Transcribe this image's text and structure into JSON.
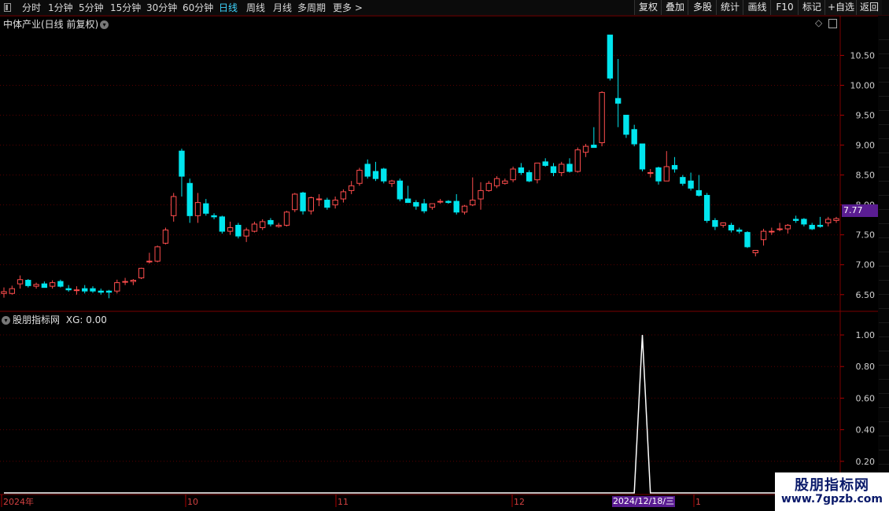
{
  "toolbar": {
    "periods": [
      "分时",
      "1分钟",
      "5分钟",
      "15分钟",
      "30分钟",
      "60分钟",
      "日线",
      "周线",
      "月线",
      "多周期",
      "更多 >"
    ],
    "active_period": "日线",
    "buttons": [
      "复权",
      "叠加",
      "多股",
      "统计",
      "画线",
      "F10",
      "标记",
      "+自选",
      "返回"
    ]
  },
  "main_panel": {
    "title": "中体产业(日线 前复权)",
    "current_price": "7.77"
  },
  "indicator_panel": {
    "title": "股朋指标网",
    "value_text": "XG: 0.00"
  },
  "x_axis": {
    "labels": [
      "2024年",
      "10",
      "11",
      "12",
      "1"
    ],
    "cursor_date": "2024/12/18/三"
  },
  "watermark": {
    "title": "股朋指标网",
    "url": "www.7gpzb.com"
  },
  "colors": {
    "up": "#ff4d4d",
    "down": "#00e5ee",
    "grid": "#5a0000",
    "indicator_line": "#ffffff",
    "active_tab": "#3fd6ff"
  },
  "chart_data": [
    {
      "type": "candlestick",
      "ylim": [
        6.3,
        10.9
      ],
      "yticks": [
        "10.50",
        "10.00",
        "9.50",
        "9.00",
        "8.50",
        "8.00",
        "7.50",
        "7.00",
        "6.50"
      ],
      "candles": [
        {
          "o": 6.52,
          "h": 6.62,
          "l": 6.45,
          "c": 6.55
        },
        {
          "o": 6.52,
          "h": 6.65,
          "l": 6.5,
          "c": 6.6
        },
        {
          "o": 6.68,
          "h": 6.82,
          "l": 6.6,
          "c": 6.75
        },
        {
          "o": 6.74,
          "h": 6.76,
          "l": 6.62,
          "c": 6.65
        },
        {
          "o": 6.64,
          "h": 6.7,
          "l": 6.6,
          "c": 6.67
        },
        {
          "o": 6.68,
          "h": 6.72,
          "l": 6.62,
          "c": 6.62
        },
        {
          "o": 6.64,
          "h": 6.74,
          "l": 6.6,
          "c": 6.7
        },
        {
          "o": 6.72,
          "h": 6.75,
          "l": 6.62,
          "c": 6.64
        },
        {
          "o": 6.6,
          "h": 6.66,
          "l": 6.55,
          "c": 6.58
        },
        {
          "o": 6.58,
          "h": 6.64,
          "l": 6.5,
          "c": 6.58
        },
        {
          "o": 6.6,
          "h": 6.66,
          "l": 6.52,
          "c": 6.56
        },
        {
          "o": 6.6,
          "h": 6.64,
          "l": 6.53,
          "c": 6.56
        },
        {
          "o": 6.56,
          "h": 6.6,
          "l": 6.5,
          "c": 6.54
        },
        {
          "o": 6.56,
          "h": 6.58,
          "l": 6.44,
          "c": 6.54
        },
        {
          "o": 6.56,
          "h": 6.75,
          "l": 6.52,
          "c": 6.7
        },
        {
          "o": 6.72,
          "h": 6.78,
          "l": 6.66,
          "c": 6.72
        },
        {
          "o": 6.72,
          "h": 6.76,
          "l": 6.66,
          "c": 6.74
        },
        {
          "o": 6.78,
          "h": 6.95,
          "l": 6.76,
          "c": 6.94
        },
        {
          "o": 7.05,
          "h": 7.2,
          "l": 7.02,
          "c": 7.06
        },
        {
          "o": 7.06,
          "h": 7.32,
          "l": 7.04,
          "c": 7.3
        },
        {
          "o": 7.36,
          "h": 7.62,
          "l": 7.34,
          "c": 7.58
        },
        {
          "o": 7.82,
          "h": 8.2,
          "l": 7.72,
          "c": 8.14
        },
        {
          "o": 8.9,
          "h": 8.94,
          "l": 8.14,
          "c": 8.48
        },
        {
          "o": 8.36,
          "h": 8.44,
          "l": 7.7,
          "c": 7.82
        },
        {
          "o": 7.82,
          "h": 8.2,
          "l": 7.7,
          "c": 8.04
        },
        {
          "o": 8.02,
          "h": 8.1,
          "l": 7.82,
          "c": 7.86
        },
        {
          "o": 7.82,
          "h": 7.86,
          "l": 7.76,
          "c": 7.8
        },
        {
          "o": 7.8,
          "h": 7.82,
          "l": 7.52,
          "c": 7.56
        },
        {
          "o": 7.56,
          "h": 7.72,
          "l": 7.5,
          "c": 7.62
        },
        {
          "o": 7.66,
          "h": 7.7,
          "l": 7.44,
          "c": 7.48
        },
        {
          "o": 7.48,
          "h": 7.62,
          "l": 7.38,
          "c": 7.58
        },
        {
          "o": 7.56,
          "h": 7.72,
          "l": 7.54,
          "c": 7.68
        },
        {
          "o": 7.62,
          "h": 7.76,
          "l": 7.58,
          "c": 7.72
        },
        {
          "o": 7.74,
          "h": 7.78,
          "l": 7.64,
          "c": 7.68
        },
        {
          "o": 7.64,
          "h": 7.7,
          "l": 7.62,
          "c": 7.66
        },
        {
          "o": 7.66,
          "h": 7.9,
          "l": 7.64,
          "c": 7.88
        },
        {
          "o": 7.92,
          "h": 8.2,
          "l": 7.88,
          "c": 8.18
        },
        {
          "o": 8.2,
          "h": 8.22,
          "l": 7.84,
          "c": 7.9
        },
        {
          "o": 7.9,
          "h": 8.14,
          "l": 7.84,
          "c": 8.12
        },
        {
          "o": 8.1,
          "h": 8.18,
          "l": 7.98,
          "c": 8.1
        },
        {
          "o": 8.08,
          "h": 8.12,
          "l": 7.92,
          "c": 7.96
        },
        {
          "o": 8.0,
          "h": 8.14,
          "l": 7.94,
          "c": 8.08
        },
        {
          "o": 8.1,
          "h": 8.26,
          "l": 8.04,
          "c": 8.22
        },
        {
          "o": 8.24,
          "h": 8.4,
          "l": 8.18,
          "c": 8.32
        },
        {
          "o": 8.36,
          "h": 8.62,
          "l": 8.32,
          "c": 8.58
        },
        {
          "o": 8.68,
          "h": 8.76,
          "l": 8.44,
          "c": 8.48
        },
        {
          "o": 8.56,
          "h": 8.72,
          "l": 8.4,
          "c": 8.44
        },
        {
          "o": 8.6,
          "h": 8.62,
          "l": 8.36,
          "c": 8.4
        },
        {
          "o": 8.36,
          "h": 8.42,
          "l": 8.3,
          "c": 8.4
        },
        {
          "o": 8.4,
          "h": 8.44,
          "l": 8.06,
          "c": 8.1
        },
        {
          "o": 8.1,
          "h": 8.32,
          "l": 8.04,
          "c": 8.04
        },
        {
          "o": 8.04,
          "h": 8.08,
          "l": 7.92,
          "c": 7.98
        },
        {
          "o": 8.02,
          "h": 8.1,
          "l": 7.86,
          "c": 7.9
        },
        {
          "o": 7.96,
          "h": 8.02,
          "l": 7.92,
          "c": 8.02
        },
        {
          "o": 8.06,
          "h": 8.1,
          "l": 8.02,
          "c": 8.06
        },
        {
          "o": 8.06,
          "h": 8.08,
          "l": 8.02,
          "c": 8.04
        },
        {
          "o": 8.06,
          "h": 8.18,
          "l": 7.84,
          "c": 7.88
        },
        {
          "o": 7.88,
          "h": 8.0,
          "l": 7.84,
          "c": 7.98
        },
        {
          "o": 8.0,
          "h": 8.46,
          "l": 7.98,
          "c": 8.08
        },
        {
          "o": 8.1,
          "h": 8.38,
          "l": 7.92,
          "c": 8.24
        },
        {
          "o": 8.24,
          "h": 8.4,
          "l": 8.22,
          "c": 8.36
        },
        {
          "o": 8.32,
          "h": 8.48,
          "l": 8.28,
          "c": 8.44
        },
        {
          "o": 8.36,
          "h": 8.44,
          "l": 8.34,
          "c": 8.4
        },
        {
          "o": 8.42,
          "h": 8.64,
          "l": 8.38,
          "c": 8.6
        },
        {
          "o": 8.62,
          "h": 8.7,
          "l": 8.5,
          "c": 8.54
        },
        {
          "o": 8.54,
          "h": 8.58,
          "l": 8.38,
          "c": 8.4
        },
        {
          "o": 8.42,
          "h": 8.7,
          "l": 8.36,
          "c": 8.7
        },
        {
          "o": 8.72,
          "h": 8.78,
          "l": 8.64,
          "c": 8.66
        },
        {
          "o": 8.64,
          "h": 8.7,
          "l": 8.48,
          "c": 8.54
        },
        {
          "o": 8.54,
          "h": 8.72,
          "l": 8.48,
          "c": 8.68
        },
        {
          "o": 8.68,
          "h": 8.78,
          "l": 8.54,
          "c": 8.56
        },
        {
          "o": 8.56,
          "h": 8.96,
          "l": 8.54,
          "c": 8.92
        },
        {
          "o": 8.88,
          "h": 9.02,
          "l": 8.8,
          "c": 8.98
        },
        {
          "o": 9.0,
          "h": 9.3,
          "l": 8.98,
          "c": 8.96
        },
        {
          "o": 9.04,
          "h": 9.9,
          "l": 8.98,
          "c": 9.88
        },
        {
          "o": 10.84,
          "h": 10.84,
          "l": 10.08,
          "c": 10.12
        },
        {
          "o": 9.78,
          "h": 10.44,
          "l": 9.3,
          "c": 9.7
        },
        {
          "o": 9.5,
          "h": 9.5,
          "l": 9.12,
          "c": 9.18
        },
        {
          "o": 9.26,
          "h": 9.34,
          "l": 8.98,
          "c": 9.02
        },
        {
          "o": 9.02,
          "h": 9.02,
          "l": 8.56,
          "c": 8.6
        },
        {
          "o": 8.54,
          "h": 8.6,
          "l": 8.46,
          "c": 8.54
        },
        {
          "o": 8.62,
          "h": 8.64,
          "l": 8.34,
          "c": 8.4
        },
        {
          "o": 8.4,
          "h": 8.9,
          "l": 8.4,
          "c": 8.64
        },
        {
          "o": 8.66,
          "h": 8.8,
          "l": 8.54,
          "c": 8.6
        },
        {
          "o": 8.46,
          "h": 8.5,
          "l": 8.32,
          "c": 8.36
        },
        {
          "o": 8.4,
          "h": 8.54,
          "l": 8.24,
          "c": 8.28
        },
        {
          "o": 8.24,
          "h": 8.5,
          "l": 8.14,
          "c": 8.16
        },
        {
          "o": 8.16,
          "h": 8.2,
          "l": 7.7,
          "c": 7.74
        },
        {
          "o": 7.74,
          "h": 7.78,
          "l": 7.58,
          "c": 7.64
        },
        {
          "o": 7.66,
          "h": 7.7,
          "l": 7.62,
          "c": 7.7
        },
        {
          "o": 7.66,
          "h": 7.7,
          "l": 7.54,
          "c": 7.58
        },
        {
          "o": 7.58,
          "h": 7.62,
          "l": 7.52,
          "c": 7.56
        },
        {
          "o": 7.54,
          "h": 7.56,
          "l": 7.28,
          "c": 7.3
        },
        {
          "o": 7.2,
          "h": 7.24,
          "l": 7.14,
          "c": 7.24
        },
        {
          "o": 7.42,
          "h": 7.6,
          "l": 7.32,
          "c": 7.56
        },
        {
          "o": 7.56,
          "h": 7.62,
          "l": 7.5,
          "c": 7.56
        },
        {
          "o": 7.6,
          "h": 7.7,
          "l": 7.56,
          "c": 7.6
        },
        {
          "o": 7.6,
          "h": 7.68,
          "l": 7.52,
          "c": 7.66
        },
        {
          "o": 7.76,
          "h": 7.82,
          "l": 7.7,
          "c": 7.74
        },
        {
          "o": 7.76,
          "h": 7.78,
          "l": 7.64,
          "c": 7.68
        },
        {
          "o": 7.66,
          "h": 7.7,
          "l": 7.58,
          "c": 7.6
        },
        {
          "o": 7.66,
          "h": 7.8,
          "l": 7.62,
          "c": 7.64
        },
        {
          "o": 7.7,
          "h": 7.8,
          "l": 7.64,
          "c": 7.76
        },
        {
          "o": 7.74,
          "h": 7.8,
          "l": 7.7,
          "c": 7.77
        }
      ]
    },
    {
      "type": "line",
      "name": "XG",
      "ylim": [
        0,
        1.05
      ],
      "yticks": [
        "1.00",
        "0.80",
        "0.60",
        "0.40",
        "0.20"
      ],
      "spike_index": 79,
      "values_default": 0
    }
  ]
}
